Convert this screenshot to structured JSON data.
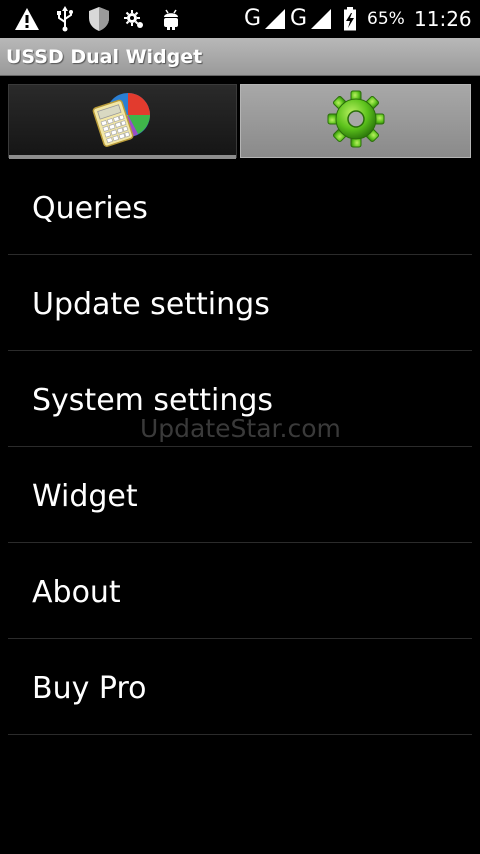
{
  "status_bar": {
    "icons": [
      "warning-icon",
      "usb-icon",
      "shield-icon",
      "debug-icon",
      "android-icon"
    ],
    "network_1": "G",
    "network_2": "G",
    "battery_percent": "65%",
    "time": "11:26"
  },
  "app": {
    "title": "USSD Dual Widget"
  },
  "tabs": [
    {
      "icon": "calculator-chart-icon",
      "selected": true
    },
    {
      "icon": "green-gear-icon",
      "selected": false
    }
  ],
  "menu": {
    "items": [
      {
        "label": "Queries"
      },
      {
        "label": "Update settings"
      },
      {
        "label": "System settings"
      },
      {
        "label": "Widget"
      },
      {
        "label": "About"
      },
      {
        "label": "Buy Pro"
      }
    ]
  },
  "watermark": "UpdateStar.com"
}
